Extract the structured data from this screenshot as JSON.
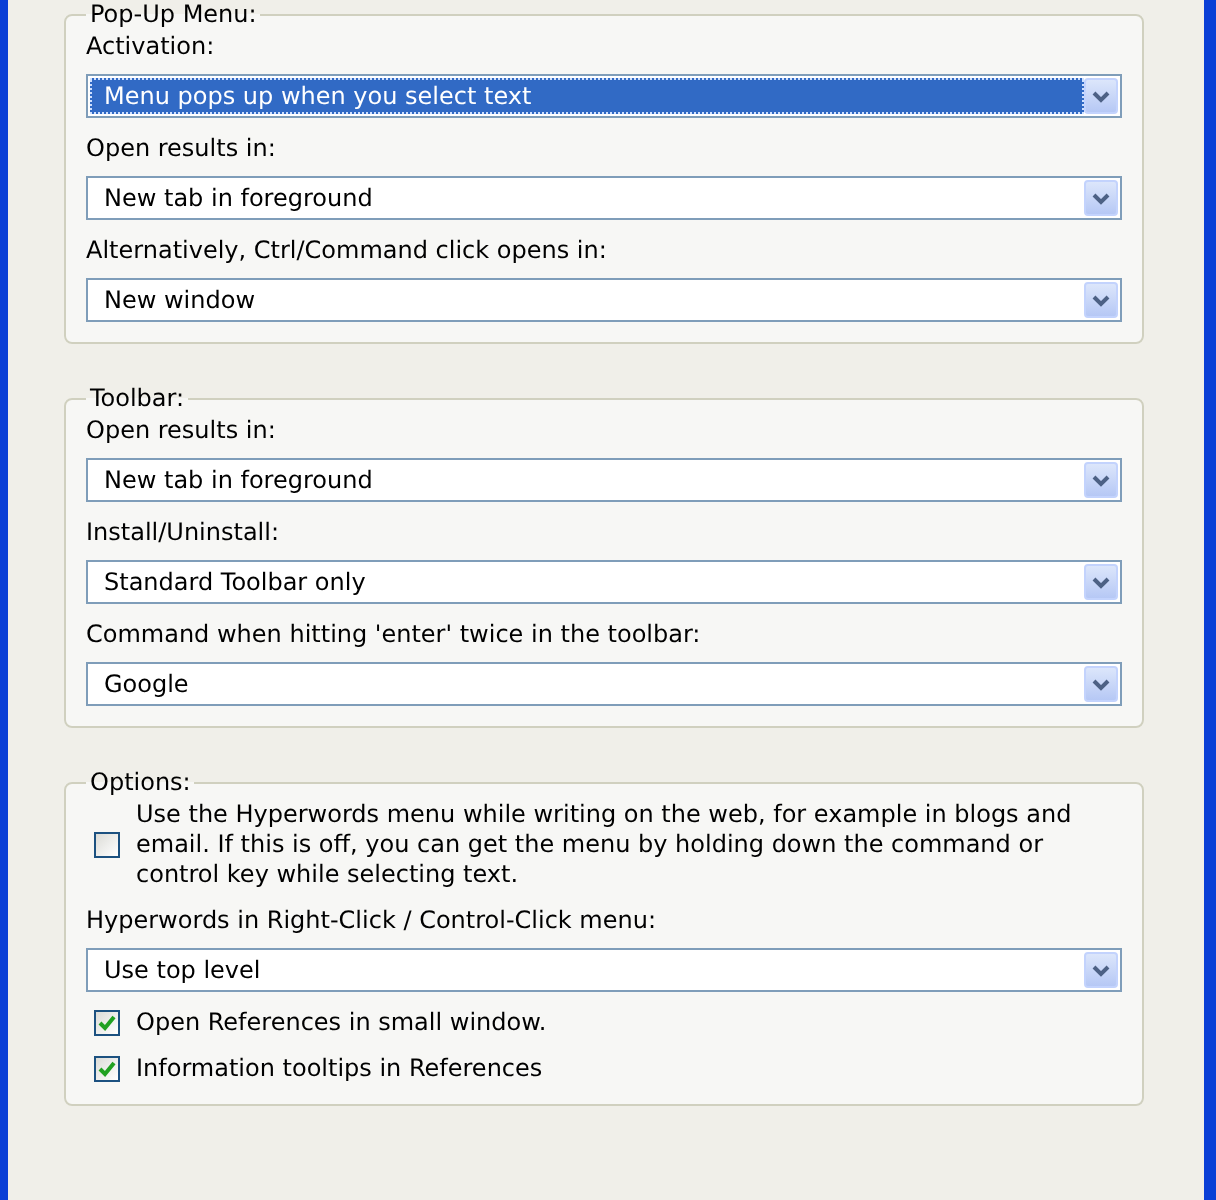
{
  "groups": [
    {
      "title": "Pop-Up Menu:",
      "items": [
        {
          "kind": "select",
          "label": "Activation:",
          "value": "Menu pops up when you select text",
          "focused": true
        },
        {
          "kind": "select",
          "label": "Open results in:",
          "value": "New tab in foreground",
          "focused": false
        },
        {
          "kind": "select",
          "label": "Alternatively, Ctrl/Command click opens in:",
          "value": "New window",
          "focused": false
        }
      ]
    },
    {
      "title": "Toolbar:",
      "items": [
        {
          "kind": "select",
          "label": "Open results in:",
          "value": "New tab in foreground",
          "focused": false
        },
        {
          "kind": "select",
          "label": "Install/Uninstall:",
          "value": "Standard Toolbar only",
          "focused": false
        },
        {
          "kind": "select",
          "label": "Command when hitting 'enter' twice in the toolbar:",
          "value": "Google",
          "focused": false
        }
      ]
    },
    {
      "title": "Options:",
      "items": [
        {
          "kind": "checkbox",
          "text": "Use the Hyperwords menu while writing on the web, for example in blogs and email. If this is off, you can get the menu by holding down the command or control key while selecting text.",
          "checked": false
        },
        {
          "kind": "select",
          "label": "Hyperwords in Right-Click / Control-Click menu:",
          "value": "Use top level",
          "focused": false
        },
        {
          "kind": "checkbox",
          "text": "Open References in small window.",
          "checked": true
        },
        {
          "kind": "checkbox",
          "text": "Information tooltips in References",
          "checked": true
        }
      ]
    }
  ]
}
